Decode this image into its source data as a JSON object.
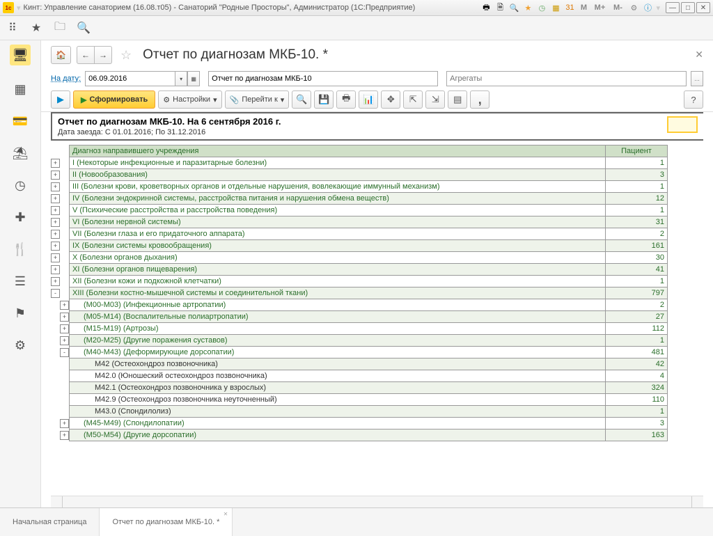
{
  "titlebar": {
    "title": "Кинт: Управление санаторием (16.08.т05) - Санаторий \"Родные Просторы\", Администратор  (1С:Предприятие)",
    "m_labels": [
      "M",
      "M+",
      "M-"
    ]
  },
  "page": {
    "title": "Отчет по диагнозам МКБ-10. *"
  },
  "filter": {
    "date_label": "На дату:",
    "date_value": "06.09.2016",
    "report_name": "Отчет по диагнозам МКБ-10",
    "agg_placeholder": "Агрегаты"
  },
  "toolbar": {
    "run": "Сформировать",
    "settings": "Настройки",
    "goto": "Перейти к"
  },
  "report": {
    "title": "Отчет по диагнозам МКБ-10. На 6 сентября 2016 г.",
    "subtitle": "Дата заезда: С 01.01.2016; По 31.12.2016",
    "col_diag": "Диагноз направившего учреждения",
    "col_pat": "Пациент"
  },
  "rows": [
    {
      "exp": "+",
      "lvl": 0,
      "diag": "I (Некоторые инфекционные и паразитарные болезни)",
      "val": "1",
      "alt": 0
    },
    {
      "exp": "+",
      "lvl": 0,
      "diag": "II (Новообразования)",
      "val": "3",
      "alt": 1
    },
    {
      "exp": "+",
      "lvl": 0,
      "diag": "III (Болезни крови, кроветворных органов и отдельные нарушения, вовлекающие иммунный механизм)",
      "val": "1",
      "alt": 0
    },
    {
      "exp": "+",
      "lvl": 0,
      "diag": "IV (Болезни эндокринной системы, расстройства питания и нарушения обмена веществ)",
      "val": "12",
      "alt": 1
    },
    {
      "exp": "+",
      "lvl": 0,
      "diag": "V (Психические расстройства и расстройства поведения)",
      "val": "1",
      "alt": 0
    },
    {
      "exp": "+",
      "lvl": 0,
      "diag": "VI (Болезни нервной системы)",
      "val": "31",
      "alt": 1
    },
    {
      "exp": "+",
      "lvl": 0,
      "diag": "VII (Болезни глаза и его придаточного аппарата)",
      "val": "2",
      "alt": 0
    },
    {
      "exp": "+",
      "lvl": 0,
      "diag": "IX (Болезни системы кровообращения)",
      "val": "161",
      "alt": 1
    },
    {
      "exp": "+",
      "lvl": 0,
      "diag": "X (Болезни органов дыхания)",
      "val": "30",
      "alt": 0
    },
    {
      "exp": "+",
      "lvl": 0,
      "diag": "XI (Болезни органов пищеварения)",
      "val": "41",
      "alt": 1
    },
    {
      "exp": "+",
      "lvl": 0,
      "diag": "XII (Болезни кожи и подкожной клетчатки)",
      "val": "1",
      "alt": 0
    },
    {
      "exp": "-",
      "lvl": 0,
      "diag": "XIII (Болезни костно-мышечной системы и соединительной ткани)",
      "val": "797",
      "alt": 1
    },
    {
      "exp": "+",
      "lvl": 1,
      "diag": "(M00-M03) (Инфекционные артропатии)",
      "val": "2",
      "alt": 0
    },
    {
      "exp": "+",
      "lvl": 1,
      "diag": "(M05-M14) (Воспалительные полиартропатии)",
      "val": "27",
      "alt": 1
    },
    {
      "exp": "+",
      "lvl": 1,
      "diag": "(M15-M19) (Артрозы)",
      "val": "112",
      "alt": 0
    },
    {
      "exp": "+",
      "lvl": 1,
      "diag": "(M20-M25) (Другие поражения суставов)",
      "val": "1",
      "alt": 1
    },
    {
      "exp": "-",
      "lvl": 1,
      "diag": "(M40-M43) (Деформирующие дорсопатии)",
      "val": "481",
      "alt": 0
    },
    {
      "exp": "",
      "lvl": 2,
      "diag": "M42 (Остеохондроз позвоночника)",
      "val": "42",
      "alt": 1
    },
    {
      "exp": "",
      "lvl": 2,
      "diag": "M42.0 (Юношеский остеохондроз позвоночника)",
      "val": "4",
      "alt": 0
    },
    {
      "exp": "",
      "lvl": 2,
      "diag": "M42.1 (Остеохондроз позвоночника у взрослых)",
      "val": "324",
      "alt": 1
    },
    {
      "exp": "",
      "lvl": 2,
      "diag": "M42.9 (Остеохондроз позвоночника неуточненный)",
      "val": "110",
      "alt": 0
    },
    {
      "exp": "",
      "lvl": 2,
      "diag": "M43.0 (Спондилолиз)",
      "val": "1",
      "alt": 1
    },
    {
      "exp": "+",
      "lvl": 1,
      "diag": "(M45-M49) (Спондилопатии)",
      "val": "3",
      "alt": 0
    },
    {
      "exp": "+",
      "lvl": 1,
      "diag": "(M50-M54) (Другие дорсопатии)",
      "val": "163",
      "alt": 1
    }
  ],
  "tabs": {
    "home": "Начальная страница",
    "report": "Отчет по диагнозам МКБ-10. *"
  }
}
